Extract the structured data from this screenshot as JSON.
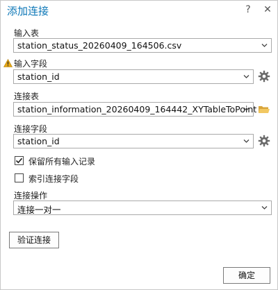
{
  "dialog": {
    "title": "添加连接",
    "help": "?",
    "close": "✕"
  },
  "input_table": {
    "label": "输入表",
    "value": "station_status_20260409_164506.csv"
  },
  "input_field": {
    "label": "输入字段",
    "value": "station_id",
    "warning": true
  },
  "join_table": {
    "label": "连接表",
    "value": "station_information_20260409_164442_XYTableToPoint"
  },
  "join_field": {
    "label": "连接字段",
    "value": "station_id"
  },
  "options": {
    "keep_all": {
      "label": "保留所有输入记录",
      "checked": true
    },
    "index_join": {
      "label": "索引连接字段",
      "checked": false
    }
  },
  "join_operation": {
    "label": "连接操作",
    "value": "连接一对一"
  },
  "buttons": {
    "validate": "验证连接",
    "ok": "确定"
  },
  "colors": {
    "title": "#0c77b7",
    "warning": "#e6a817",
    "folder": "#e8b84a"
  }
}
